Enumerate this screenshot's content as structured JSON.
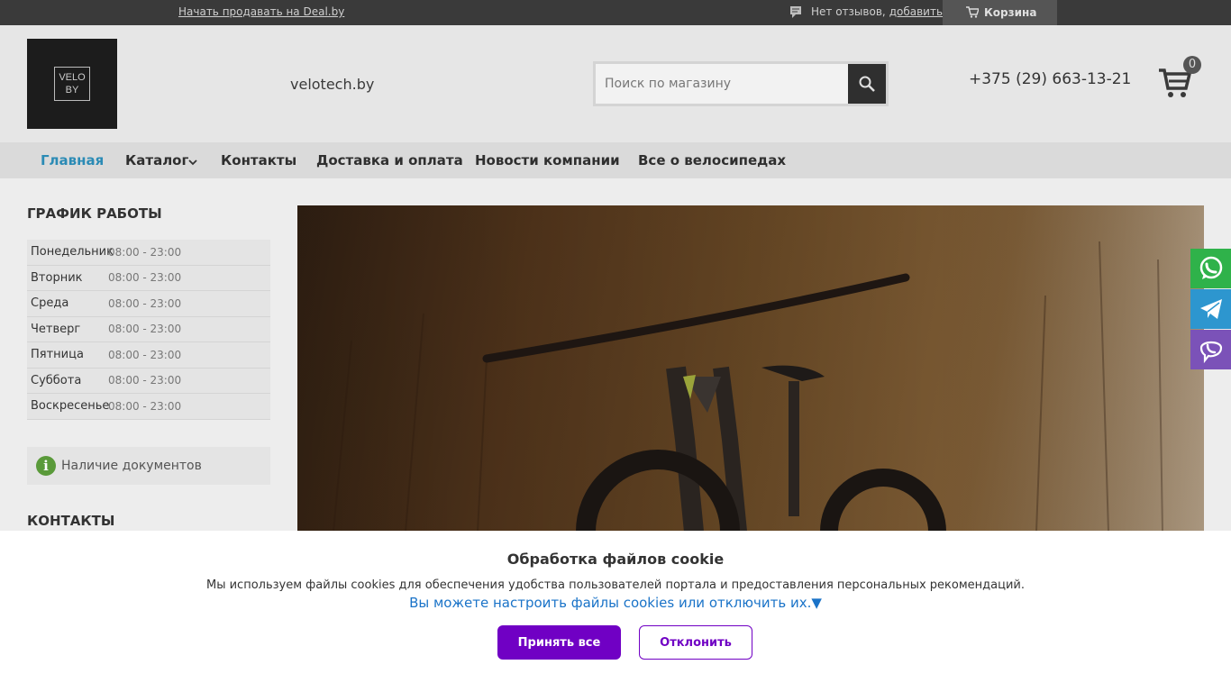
{
  "topbar": {
    "sell_link": "Начать продавать на Deal.by",
    "reviews_text": "Нет отзывов,",
    "reviews_add": "добавить",
    "cart_label": "Корзина"
  },
  "header": {
    "logo_text_line1": "VELO",
    "logo_text_line2": "BY",
    "site_name": "velotech.by",
    "search_placeholder": "Поиск по магазину",
    "phone": "+375 (29) 663-13-21",
    "cart_count": "0"
  },
  "nav": {
    "items": [
      {
        "label": "Главная"
      },
      {
        "label": "Каталог"
      },
      {
        "label": "Контакты"
      },
      {
        "label": "Доставка и оплата"
      },
      {
        "label": "Новости компании"
      },
      {
        "label": "Все о велосипедах"
      }
    ]
  },
  "schedule": {
    "title": "ГРАФИК РАБОТЫ",
    "rows": [
      {
        "day": "Понедельник",
        "time": "08:00 - 23:00"
      },
      {
        "day": "Вторник",
        "time": "08:00 - 23:00"
      },
      {
        "day": "Среда",
        "time": "08:00 - 23:00"
      },
      {
        "day": "Четверг",
        "time": "08:00 - 23:00"
      },
      {
        "day": "Пятница",
        "time": "08:00 - 23:00"
      },
      {
        "day": "Суббота",
        "time": "08:00 - 23:00"
      },
      {
        "day": "Воскресенье",
        "time": "08:00 - 23:00"
      }
    ]
  },
  "sidebar": {
    "docs_label": "Наличие документов",
    "contacts_title": "КОНТАКТЫ"
  },
  "social": {
    "whatsapp_color": "#2fb24a",
    "telegram_color": "#2d96cf",
    "viber_color": "#7b52b8"
  },
  "cookie": {
    "title": "Обработка файлов cookie",
    "description": "Мы используем файлы cookies для обеспечения удобства пользователей портала и предоставления персональных рекомендаций.",
    "settings_link": "Вы можете настроить файлы cookies или отключить их.▼",
    "accept_label": "Принять все",
    "decline_label": "Отклонить",
    "accent_color": "#7000c4"
  }
}
